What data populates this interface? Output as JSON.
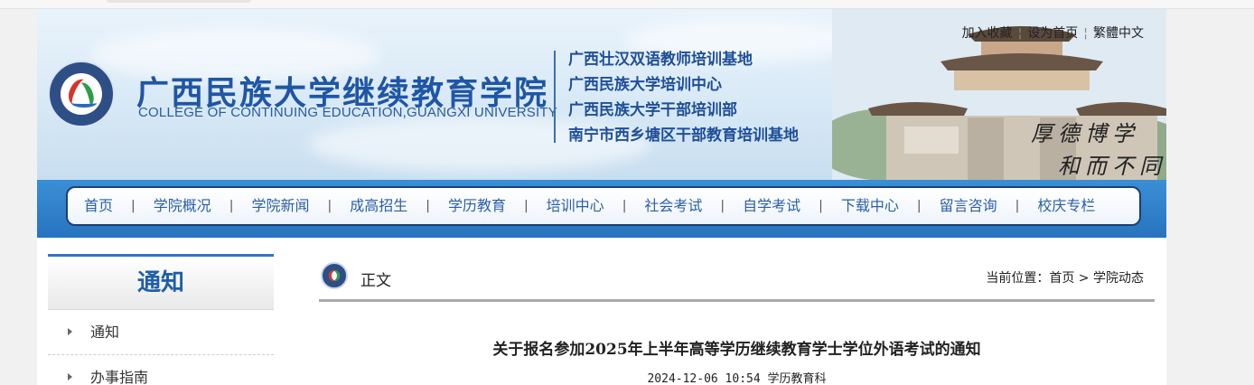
{
  "header": {
    "school_cn": "广西民族大学继续教育学院",
    "school_en": "COLLEGE OF CONTINUING EDUCATION,GUANGXI UNIVERSITY",
    "bases": [
      "广西壮汉双语教师培训基地",
      "广西民族大学培训中心",
      "广西民族大学干部培训部",
      "南宁市西乡塘区干部教育培训基地"
    ],
    "top_links": [
      "加入收藏",
      "设为首页",
      "繁體中文"
    ],
    "motto": [
      "厚德博学",
      "和而不同"
    ]
  },
  "nav": {
    "items": [
      "首页",
      "学院概况",
      "学院新闻",
      "成高招生",
      "学历教育",
      "培训中心",
      "社会考试",
      "自学考试",
      "下载中心",
      "留言咨询",
      "校庆专栏"
    ]
  },
  "sidebar": {
    "title": "通知",
    "items": [
      "通知",
      "办事指南"
    ]
  },
  "content": {
    "section": "正文",
    "location_label": "当前位置：首页 > 学院动态",
    "article_title": "关于报名参加2025年上半年高等学历继续教育学士学位外语考试的通知",
    "article_meta": "2024-12-06 10:54 学历教育科"
  },
  "colors": {
    "brand_blue": "#1f56a5",
    "nav_blue": "#2873bf",
    "accent_red": "#d7342b",
    "accent_green": "#2e9c4a"
  }
}
